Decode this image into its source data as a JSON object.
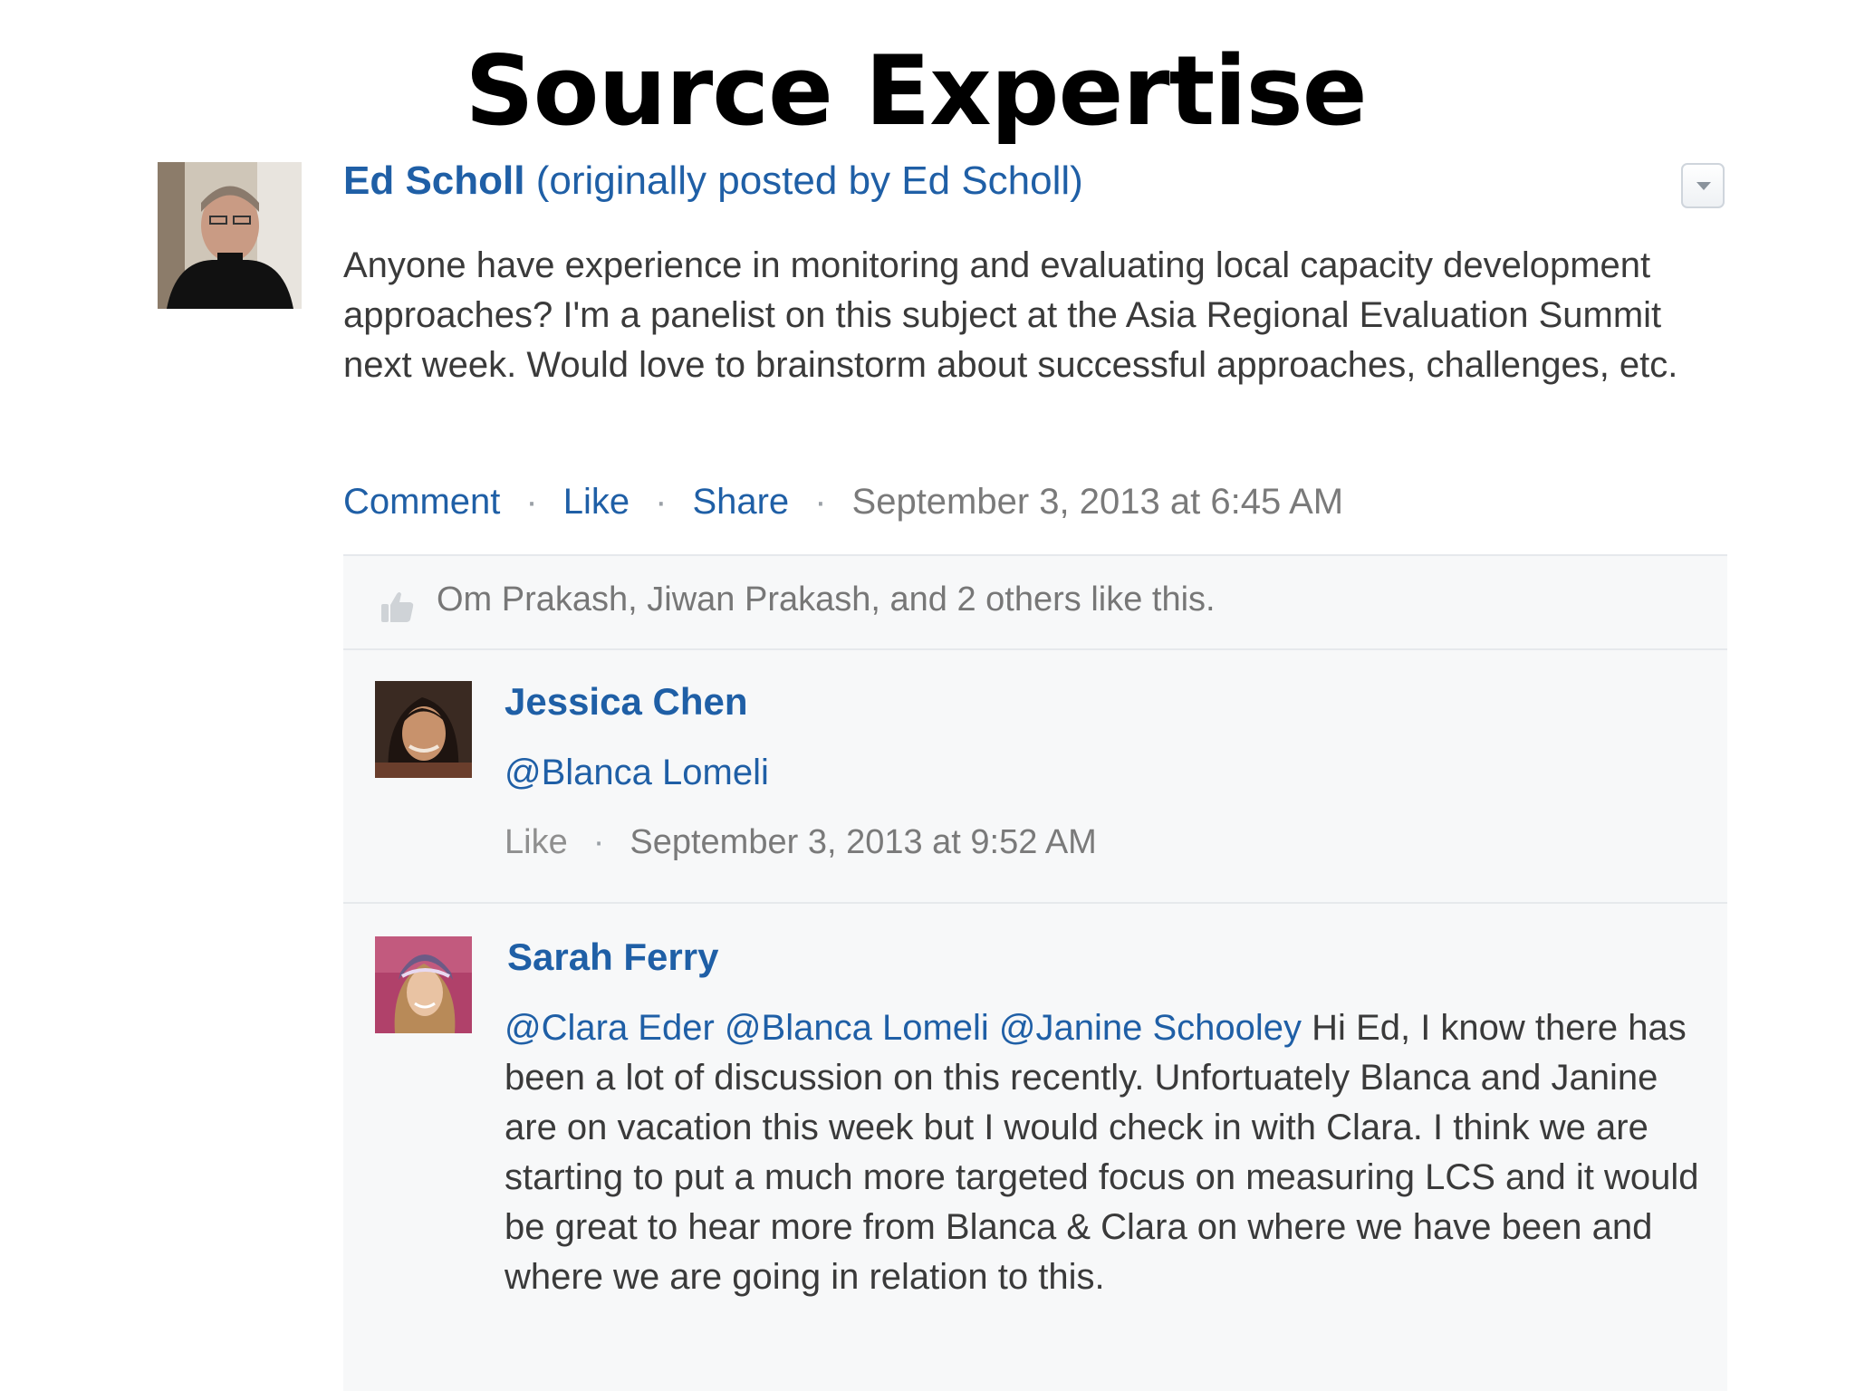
{
  "slide": {
    "title": "Source Expertise"
  },
  "post": {
    "author": "Ed Scholl",
    "paren_open": "(",
    "originally_posted_by": "originally posted by",
    "original_author": "Ed Scholl",
    "paren_close": ")",
    "body": "Anyone have experience in monitoring and evaluating local capacity development approaches? I'm a panelist on this subject at the Asia Regional Evaluation Summit next week. Would love to brainstorm about successful approaches, challenges, etc.",
    "actions": {
      "comment": "Comment",
      "like": "Like",
      "share": "Share",
      "separator": "·",
      "timestamp": "September 3, 2013 at 6:45 AM"
    },
    "likes_text": "Om Prakash, Jiwan Prakash, and 2 others like this."
  },
  "comments": [
    {
      "author": "Jessica Chen",
      "mention": "@Blanca Lomeli",
      "like": "Like",
      "separator": "·",
      "timestamp": "September 3, 2013 at 9:52 AM"
    },
    {
      "author": "Sarah Ferry",
      "mention_1": "@Clara Eder",
      "mention_2": "@Blanca Lomeli",
      "mention_3": "@Janine Schooley",
      "text": " Hi Ed, I know there has been a lot of discussion on this recently. Unfortuately Blanca and Janine are on vacation this week but I would check in with Clara. I think we are starting to put a much more targeted focus on measuring LCS and it would be great to hear more from Blanca & Clara on where we have been and where we are going in relation to this."
    }
  ],
  "icons": {
    "menu": "chevron-down-icon",
    "like": "thumbs-up-icon"
  },
  "colors": {
    "link": "#1f5fa6",
    "text": "#3a3a3a",
    "muted": "#7a7a7a",
    "panel": "#f7f8f9"
  }
}
